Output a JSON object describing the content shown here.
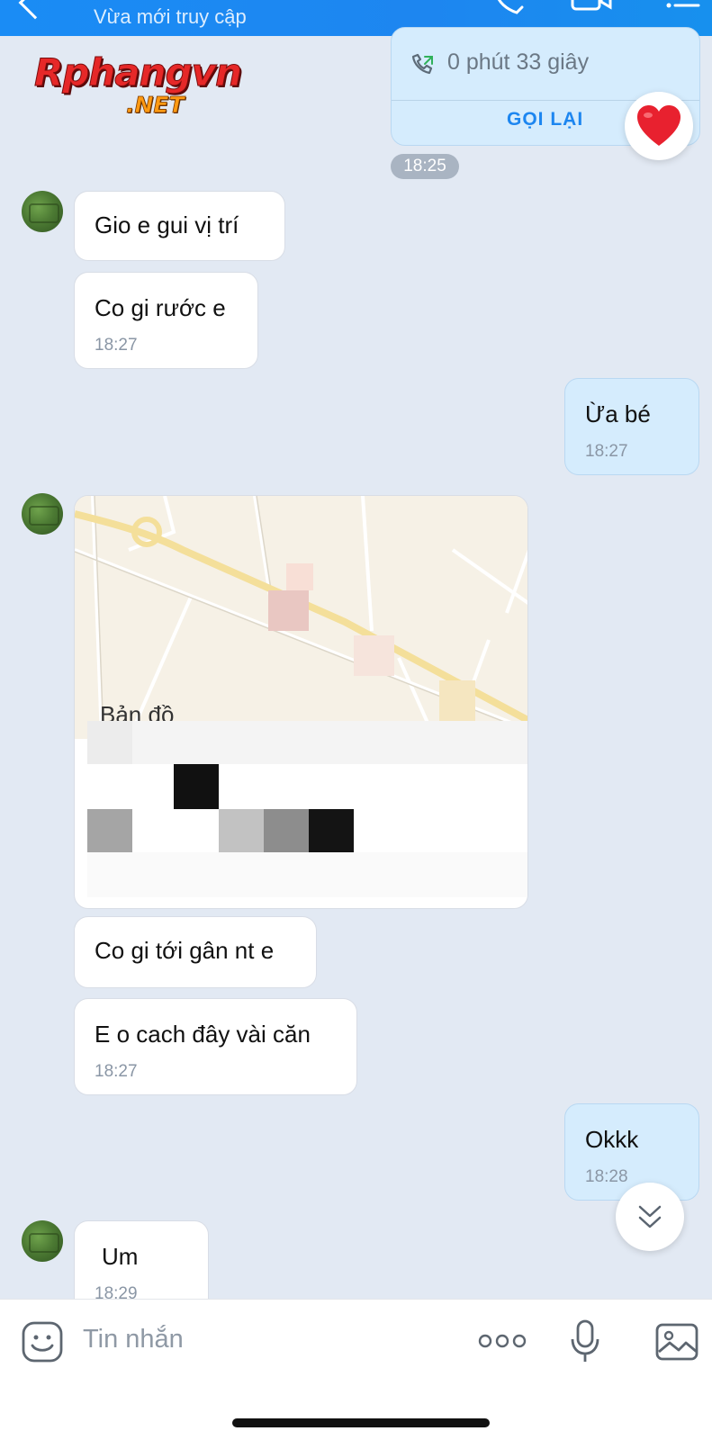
{
  "header": {
    "subtitle": "Vừa mới truy cập"
  },
  "logo": {
    "main": "Rphangvn",
    "suffix": ".NET"
  },
  "call": {
    "duration": "0 phút 33 giây",
    "callback_label": "GỌI LẠI",
    "time": "18:25"
  },
  "messages": [
    {
      "sender": "other",
      "text": "Gio e gui vị trí",
      "time": ""
    },
    {
      "sender": "other",
      "text": "Co gi rước e",
      "time": "18:27"
    },
    {
      "sender": "me",
      "text": "Ừa bé",
      "time": "18:27"
    },
    {
      "sender": "other",
      "text": "Co gi tới gân nt e",
      "time": ""
    },
    {
      "sender": "other",
      "text": "E o cach đây vài căn",
      "time": "18:27"
    },
    {
      "sender": "me",
      "text": "Okkk",
      "time": "18:28"
    },
    {
      "sender": "other",
      "text": "Um",
      "time": "18:29"
    }
  ],
  "map": {
    "label": "Bản đồ"
  },
  "input": {
    "placeholder": "Tin nhắn"
  },
  "colors": {
    "header_blue": "#1d86f0",
    "my_bubble": "#d5ecfd",
    "background": "#e2e9f3"
  }
}
